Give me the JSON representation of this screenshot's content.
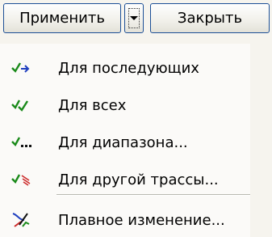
{
  "toolbar": {
    "apply_label": "Применить",
    "close_label": "Закрыть"
  },
  "menu": {
    "items": [
      {
        "label": "Для последующих",
        "icon": "check-arrow-icon"
      },
      {
        "label": "Для всех",
        "icon": "double-check-icon"
      },
      {
        "label": "Для диапазона...",
        "icon": "check-dots-icon"
      },
      {
        "label": "Для другой трассы...",
        "icon": "check-route-icon"
      },
      {
        "label": "Плавное изменение...",
        "icon": "smooth-change-icon"
      }
    ]
  },
  "colors": {
    "check_green": "#1a8a1a",
    "arrow_blue": "#1f3fbf",
    "route_red": "#cc2a2a",
    "button_border": "#1c4f96"
  }
}
